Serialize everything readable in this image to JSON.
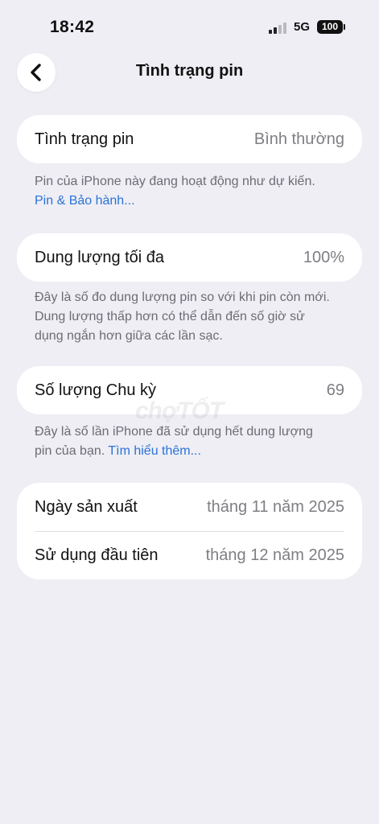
{
  "status_bar": {
    "time": "18:42",
    "network": "5G",
    "battery": "100"
  },
  "nav": {
    "title": "Tình trạng pin"
  },
  "battery_health": {
    "label": "Tình trạng pin",
    "value": "Bình thường",
    "note": "Pin của iPhone này đang hoạt động như dự kiến.",
    "link": "Pin & Bảo hành..."
  },
  "max_capacity": {
    "label": "Dung lượng tối đa",
    "value": "100%",
    "note_line1": "Đây là số đo dung lượng pin so với khi pin còn mới.",
    "note_line2": "Dung lượng thấp hơn có thể dẫn đến số giờ sử",
    "note_line3": "dụng ngắn hơn giữa các lần sạc."
  },
  "cycle_count": {
    "label": "Số lượng Chu kỳ",
    "value": "69",
    "note_line1": "Đây là số lần iPhone đã sử dụng hết dung lượng",
    "note_line2": "pin của bạn.",
    "link": "Tìm hiểu thêm..."
  },
  "dates": {
    "manufacture_label": "Ngày sản xuất",
    "manufacture_value": "tháng 11 năm 2025",
    "first_use_label": "Sử dụng đầu tiên",
    "first_use_value": "tháng 12 năm 2025"
  },
  "watermark": "chợTỐT"
}
